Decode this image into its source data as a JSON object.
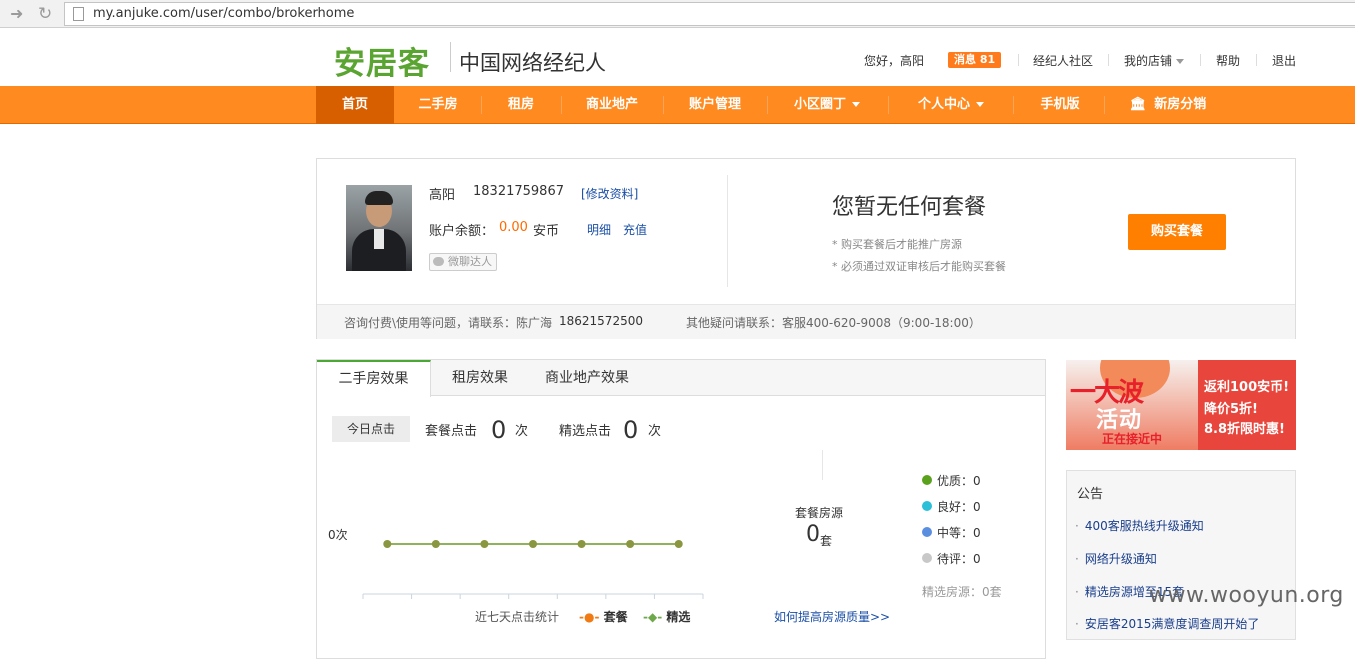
{
  "browser": {
    "back_icon": "arrow-right-icon",
    "reload_icon": "reload-icon",
    "url": "my.anjuke.com/user/combo/brokerhome"
  },
  "header": {
    "logo": "安居客",
    "subtitle": "中国网络经纪人",
    "greeting": "您好，高阳",
    "messages_label": "消息",
    "messages_count": "81",
    "links": {
      "community": "经纪人社区",
      "my_store": "我的店铺",
      "help": "帮助",
      "logout": "退出"
    }
  },
  "nav": {
    "items": [
      {
        "label": "首页"
      },
      {
        "label": "二手房"
      },
      {
        "label": "租房"
      },
      {
        "label": "商业地产"
      },
      {
        "label": "账户管理"
      },
      {
        "label": "小区圈丁"
      },
      {
        "label": "个人中心"
      },
      {
        "label": "手机版"
      },
      {
        "label": "新房分销"
      }
    ]
  },
  "profile": {
    "name": "高阳",
    "phone": "18321759867",
    "edit_label": "[修改资料]",
    "balance_label": "账户余额：",
    "balance_value": "0.00",
    "balance_unit": "安币",
    "detail_label": "明细",
    "recharge_label": "充值",
    "wechat_label": "微聊达人",
    "no_package_title": "您暂无任何套餐",
    "note1": "* 购买套餐后才能推广房源",
    "note2": "* 必须通过双证审核后才能购买套餐",
    "buy_button": "购买套餐",
    "contact_text": "咨询付费\\使用等问题，请联系：陈广海",
    "contact_phone": "18621572500",
    "other_text": "其他疑问请联系：客服400-620-9008（9:00-18:00）"
  },
  "effects": {
    "tabs": [
      {
        "label": "二手房效果"
      },
      {
        "label": "租房效果"
      },
      {
        "label": "商业地产效果"
      }
    ],
    "today_label": "今日点击",
    "package_clicks_label": "套餐点击",
    "package_clicks": "0",
    "featured_clicks_label": "精选点击",
    "featured_clicks": "0",
    "times_unit": "次",
    "chart_ylabel": "0次",
    "chart_caption": "近七天点击统计",
    "legend_package": "套餐",
    "legend_featured": "精选",
    "package_listings_label": "套餐房源",
    "package_listings_value": "0",
    "package_listings_unit": "套",
    "quality": {
      "excellent": "优质：0",
      "good": "良好：0",
      "medium": "中等：0",
      "pending": "待评：0"
    },
    "featured_listings": "精选房源：0套",
    "improve_link": "如何提高房源质量>>",
    "colors": {
      "excellent": "#5aa21e",
      "good": "#2bc0d8",
      "medium": "#5a8fe0",
      "pending": "#c8c8c8",
      "package": "#f07a14",
      "featured": "#6fa84a"
    }
  },
  "chart_data": {
    "type": "line",
    "x": [
      "d1",
      "d2",
      "d3",
      "d4",
      "d5",
      "d6",
      "d7"
    ],
    "series": [
      {
        "name": "套餐",
        "values": [
          0,
          0,
          0,
          0,
          0,
          0,
          0
        ]
      },
      {
        "name": "精选",
        "values": [
          0,
          0,
          0,
          0,
          0,
          0,
          0
        ]
      }
    ]
  },
  "promo": {
    "big": "一大波",
    "mid": "活动",
    "small": "正在接近中",
    "line1": "返利100安币!",
    "line2": "降价5折!",
    "line3": "8.8折限时惠!"
  },
  "notice": {
    "title": "公告",
    "items": [
      "400客服热线升级通知",
      "网络升级通知",
      "精选房源增至15套",
      "安居客2015满意度调查周开始了"
    ]
  },
  "watermark": "www.wooyun.org"
}
